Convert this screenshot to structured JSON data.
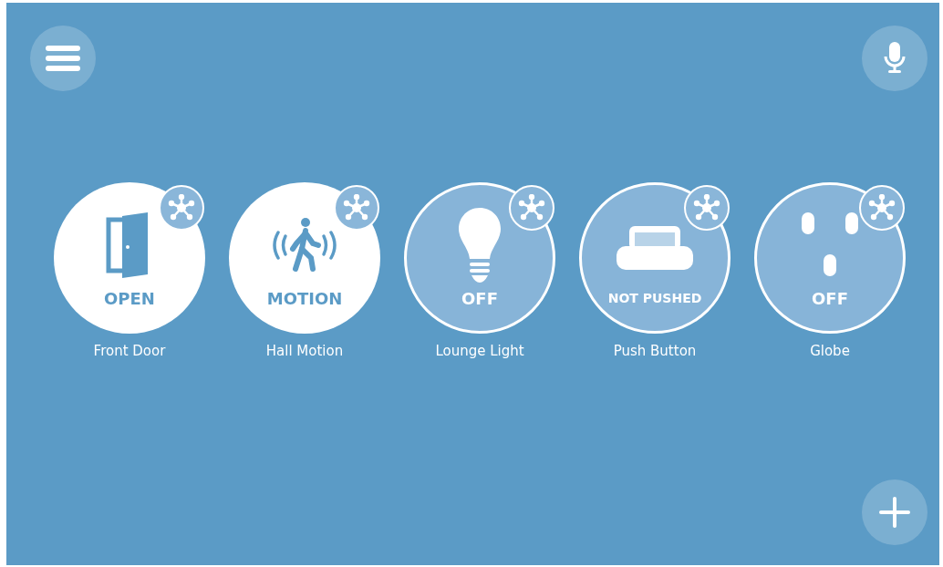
{
  "devices": [
    {
      "kind": "door",
      "state": "OPEN",
      "on": true,
      "name": "Front Door"
    },
    {
      "kind": "motion",
      "state": "MOTION",
      "on": true,
      "name": "Hall Motion"
    },
    {
      "kind": "bulb",
      "state": "OFF",
      "on": false,
      "name": "Lounge Light"
    },
    {
      "kind": "pushbutton",
      "state": "NOT PUSHED",
      "on": false,
      "name": "Push Button"
    },
    {
      "kind": "outlet",
      "state": "OFF",
      "on": false,
      "name": "Globe"
    }
  ]
}
